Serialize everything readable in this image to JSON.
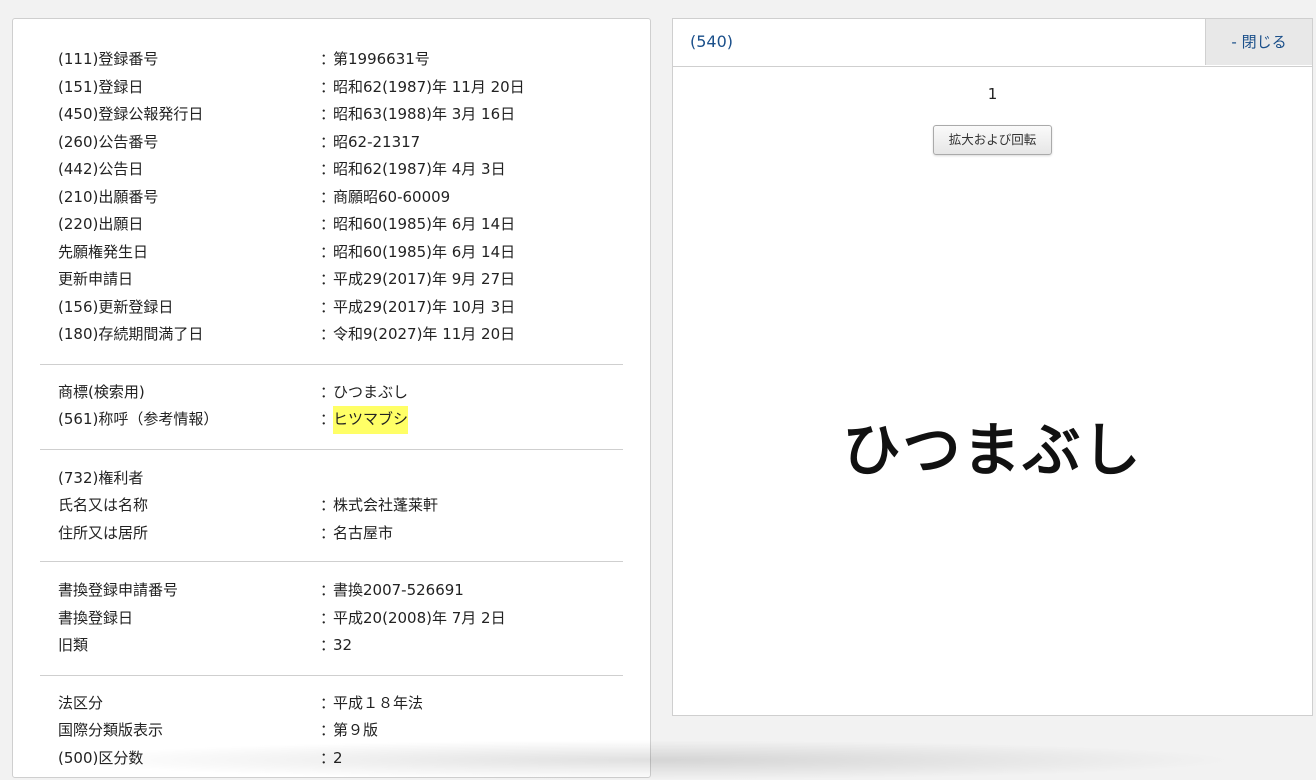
{
  "sections": [
    {
      "rows": [
        {
          "label": "(111)登録番号",
          "value": "第1996631号"
        },
        {
          "label": "(151)登録日",
          "value": "昭和62(1987)年 11月 20日"
        },
        {
          "label": "(450)登録公報発行日",
          "value": "昭和63(1988)年 3月 16日"
        },
        {
          "label": "(260)公告番号",
          "value": "昭62-21317"
        },
        {
          "label": "(442)公告日",
          "value": "昭和62(1987)年 4月 3日"
        },
        {
          "label": "(210)出願番号",
          "value": "商願昭60-60009"
        },
        {
          "label": "(220)出願日",
          "value": "昭和60(1985)年 6月 14日"
        },
        {
          "label": "先願権発生日",
          "value": "昭和60(1985)年 6月 14日"
        },
        {
          "label": "更新申請日",
          "value": "平成29(2017)年 9月 27日"
        },
        {
          "label": "(156)更新登録日",
          "value": "平成29(2017)年 10月 3日"
        },
        {
          "label": "(180)存続期間満了日",
          "value": "令和9(2027)年 11月 20日"
        }
      ]
    },
    {
      "rows": [
        {
          "label": "商標(検索用)",
          "value": "ひつまぶし"
        },
        {
          "label": "(561)称呼（参考情報）",
          "value": "ヒツマブシ"
        }
      ]
    },
    {
      "rows": [
        {
          "label": "(732)権利者",
          "value": ""
        },
        {
          "label": "氏名又は名称",
          "value": "株式会社蓬莱軒"
        },
        {
          "label": "住所又は居所",
          "value": "名古屋市"
        }
      ]
    },
    {
      "rows": [
        {
          "label": "書換登録申請番号",
          "value": "書換2007-526691"
        },
        {
          "label": "書換登録日",
          "value": "平成20(2008)年 7月 2日"
        },
        {
          "label": "旧類",
          "value": "32"
        }
      ]
    },
    {
      "rows": [
        {
          "label": "法区分",
          "value": "平成１８年法"
        },
        {
          "label": "国際分類版表示",
          "value": "第９版"
        },
        {
          "label": "(500)区分数",
          "value": "2"
        }
      ]
    }
  ],
  "separator": "：",
  "right_panel": {
    "title": "(540)",
    "close_label": "- 閉じる",
    "page_number": "1",
    "rotate_label": "拡大および回転",
    "mark_text": "ひつまぶし"
  }
}
